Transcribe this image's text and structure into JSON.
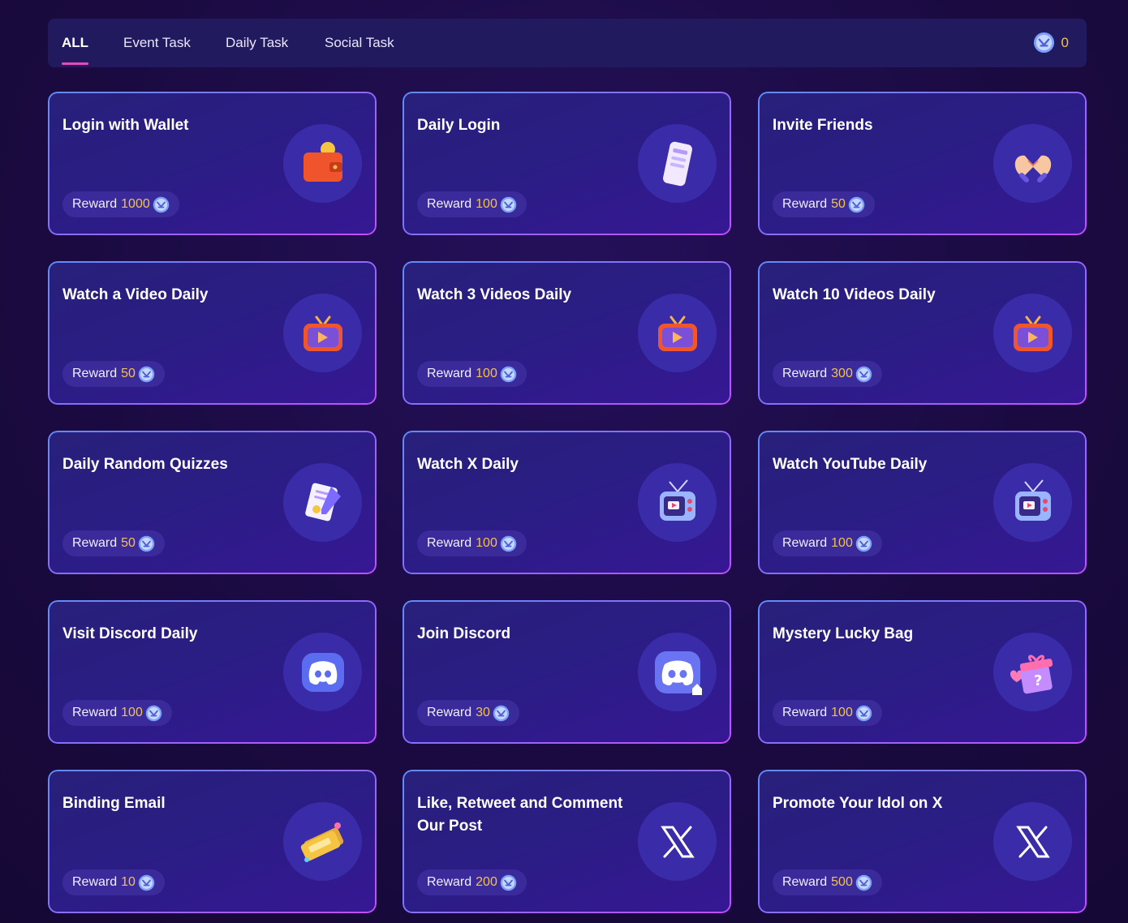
{
  "tabs": [
    {
      "label": "ALL",
      "active": true
    },
    {
      "label": "Event Task",
      "active": false
    },
    {
      "label": "Daily Task",
      "active": false
    },
    {
      "label": "Social Task",
      "active": false
    }
  ],
  "balance": {
    "value": "0",
    "icon": "coin-icon"
  },
  "reward_label": "Reward",
  "colors": {
    "accent": "#e64bb8",
    "reward_amount": "#f3c24a",
    "card_border": "#8a6cff"
  },
  "tasks": [
    {
      "title": "Login with Wallet",
      "reward": "1000",
      "icon": "wallet-icon"
    },
    {
      "title": "Daily Login",
      "reward": "100",
      "icon": "phone-icon"
    },
    {
      "title": "Invite Friends",
      "reward": "50",
      "icon": "heart-hands-icon"
    },
    {
      "title": "Watch a Video Daily",
      "reward": "50",
      "icon": "tv-play-icon"
    },
    {
      "title": "Watch 3 Videos Daily",
      "reward": "100",
      "icon": "tv-play-icon"
    },
    {
      "title": "Watch 10 Videos Daily",
      "reward": "300",
      "icon": "tv-play-icon"
    },
    {
      "title": "Daily Random Quizzes",
      "reward": "50",
      "icon": "quiz-paper-icon"
    },
    {
      "title": "Watch X Daily",
      "reward": "100",
      "icon": "retro-tv-icon"
    },
    {
      "title": "Watch YouTube Daily",
      "reward": "100",
      "icon": "retro-tv-icon"
    },
    {
      "title": "Visit Discord Daily",
      "reward": "100",
      "icon": "discord-icon"
    },
    {
      "title": "Join Discord",
      "reward": "30",
      "icon": "discord-home-icon"
    },
    {
      "title": "Mystery Lucky Bag",
      "reward": "100",
      "icon": "gift-box-icon"
    },
    {
      "title": "Binding Email",
      "reward": "10",
      "icon": "ticket-icon"
    },
    {
      "title": "Like, Retweet and Comment Our Post",
      "reward": "200",
      "icon": "x-logo-icon"
    },
    {
      "title": "Promote Your Idol on X",
      "reward": "500",
      "icon": "x-logo-icon"
    }
  ]
}
